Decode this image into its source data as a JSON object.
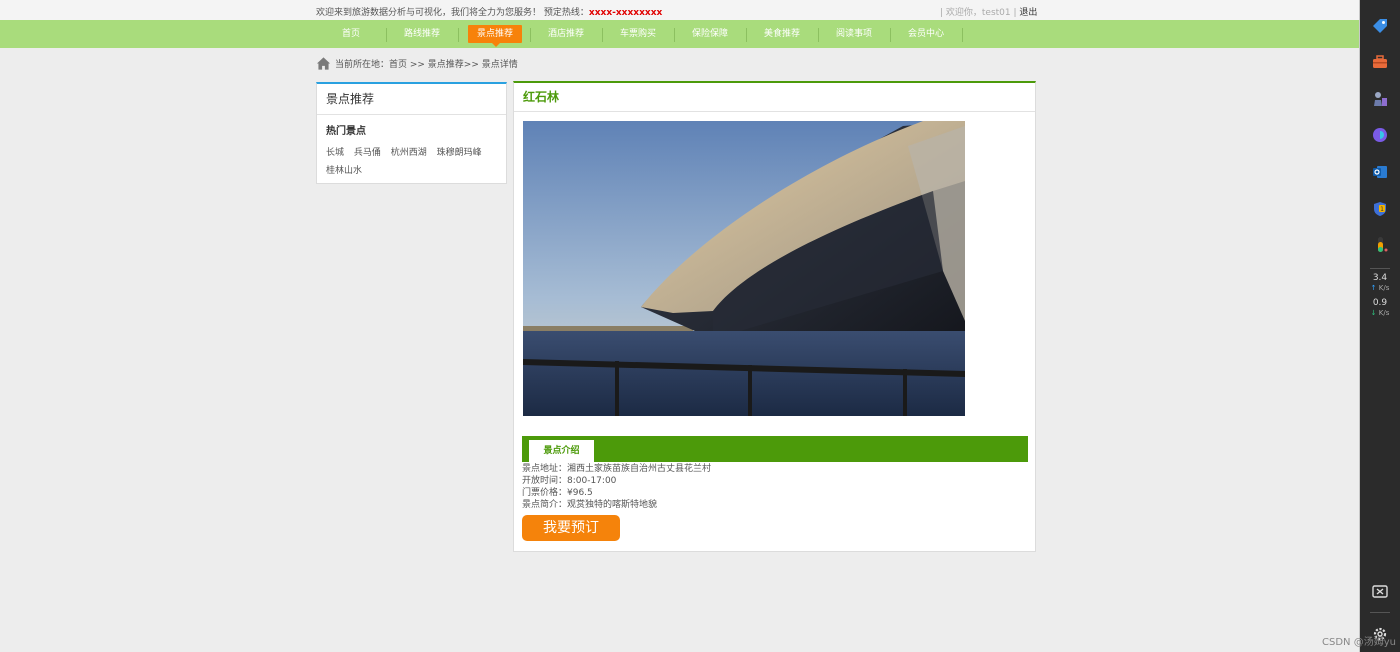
{
  "top_bar": {
    "welcome_text": "欢迎来到旅游数据分析与可视化，我们将全力为您服务！",
    "hotline_label": "预定热线：",
    "hotline_number": "xxxx-xxxxxxxx",
    "greeting": "| 欢迎你，test01 |",
    "logout_label": "退出"
  },
  "nav": {
    "items": [
      {
        "label": "首页"
      },
      {
        "label": "路线推荐"
      },
      {
        "label": "景点推荐",
        "active": true
      },
      {
        "label": "酒店推荐"
      },
      {
        "label": "车票购买"
      },
      {
        "label": "保险保障"
      },
      {
        "label": "美食推荐"
      },
      {
        "label": "阅读事项"
      },
      {
        "label": "会员中心"
      }
    ]
  },
  "breadcrumb": {
    "text": "当前所在地：首页 >> 景点推荐>> 景点详情"
  },
  "sidebar": {
    "title": "景点推荐",
    "hot_title": "热门景点",
    "hot_spots": [
      "长城",
      "兵马俑",
      "杭州西湖",
      "珠穆朗玛峰",
      "桂林山水"
    ]
  },
  "spot": {
    "name": "红石林",
    "intro_tab": "景点介绍",
    "address": "景点地址：湘西土家族苗族自治州古丈县花兰村",
    "open_time": "开放时间：8:00-17:00",
    "price": "门票价格：¥96.5",
    "description": "景点简介：观赏独特的喀斯特地貌",
    "book_label": "我要预订"
  },
  "side_panel": {
    "upload_speed": "3.4",
    "download_speed": "0.9",
    "speed_unit": "K/s",
    "icons": [
      "tag-icon",
      "toolbox-icon",
      "chess-icon",
      "copilot-icon",
      "outlook-icon",
      "shield-icon",
      "thermometer-icon",
      "screenshot-icon",
      "settings-icon"
    ]
  },
  "watermark": "CSDN @汤姆yu",
  "colors": {
    "nav_bg": "#a9dc7c",
    "accent_orange": "#f7820a",
    "green": "#4c9a0a",
    "blue": "#2aa1e0",
    "hotline_red": "#e00000"
  }
}
